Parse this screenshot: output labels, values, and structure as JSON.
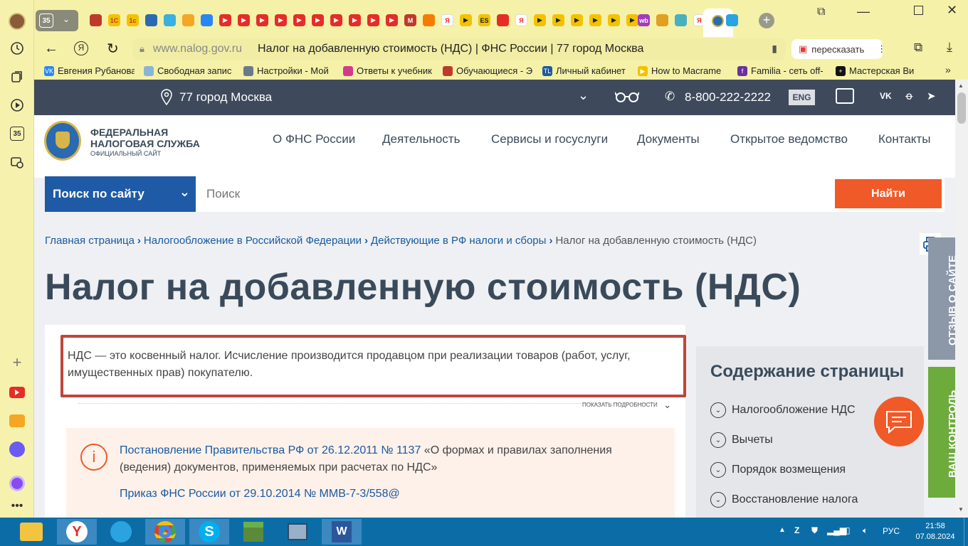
{
  "tabstrip": {
    "tab_count": "35"
  },
  "toolbar": {
    "url_domain": "www.nalog.gov.ru",
    "page_title": "Налог на добавленную стоимость (НДС) | ФНС России | 77 город Москва",
    "retell_label": "пересказать"
  },
  "left_rail": {
    "badge": "35"
  },
  "bookmarks": [
    {
      "label": "Евгения Рубанова",
      "icon_color": "#2787f5",
      "icon": "VK"
    },
    {
      "label": "Свободная запис",
      "icon_color": "#8ab4d6",
      "icon": ""
    },
    {
      "label": "Настройки - Мой",
      "icon_color": "#6a7a8a",
      "icon": ""
    },
    {
      "label": "Ответы к учебник",
      "icon_color": "#d43a8a",
      "icon": ""
    },
    {
      "label": "Обучающиеся - Э",
      "icon_color": "#c0392b",
      "icon": ""
    },
    {
      "label": "Личный кабинет",
      "icon_color": "#1e5aa0",
      "icon": "TL"
    },
    {
      "label": "How to Macrame",
      "icon_color": "#f2c200",
      "icon": "▶"
    },
    {
      "label": "Familia - сеть off-",
      "icon_color": "#6a2fa0",
      "icon": "f"
    },
    {
      "label": "Мастерская Ви",
      "icon_color": "#111111",
      "icon": "+"
    }
  ],
  "site": {
    "region": "77 город Москва",
    "phone": "8-800-222-2222",
    "lang": "ENG",
    "logo_line1": "ФЕДЕРАЛЬНАЯ",
    "logo_line2": "НАЛОГОВАЯ СЛУЖБА",
    "logo_line3": "ОФИЦИАЛЬНЫЙ САЙТ",
    "nav": [
      "О ФНС России",
      "Деятельность",
      "Сервисы и госуслуги",
      "Документы",
      "Открытое ведомство",
      "Контакты"
    ],
    "search_scope": "Поиск по сайту",
    "search_placeholder": "Поиск",
    "search_button": "Найти",
    "breadcrumbs": [
      "Главная страница",
      "Налогообложение в Российской Федерации",
      "Действующие в РФ налоги и сборы",
      "Налог на добавленную стоимость (НДС)"
    ],
    "title": "Налог на добавленную стоимость (НДС)",
    "notice_text": "НДС — это косвенный налог. Исчисление производится продавцом при реализации товаров (работ, услуг, имущественных прав) покупателю.",
    "show_details": "ПОКАЗАТЬ ПОДРОБНОСТИ",
    "info_link1": "Постановление Правительства РФ от 26.12.2011 № 1137",
    "info_text1": " «О формах и правилах заполнения (ведения) документов, применяемых при расчетах по НДС»",
    "info_link2": "Приказ ФНС России от 29.10.2014 № ММВ-7-3/558@",
    "toc_title": "Содержание страницы",
    "toc_items": [
      "Налогообложение НДС",
      "Вычеты",
      "Порядок возмещения",
      "Восстановление налога"
    ],
    "feedback_tab": "ОТЗЫВ О САЙТЕ",
    "control_tab": "ВАШ КОНТРОЛЬ"
  },
  "taskbar": {
    "lang": "РУС",
    "time": "21:58",
    "date": "07.08.2024"
  },
  "colors": {
    "fns_dark": "#3e4a5c",
    "accent_orange": "#ef5a28",
    "notice_border": "#c0453a",
    "link": "#1a5aa0",
    "browser_bg": "#f5f1a8",
    "taskbar": "#0c6da6"
  }
}
